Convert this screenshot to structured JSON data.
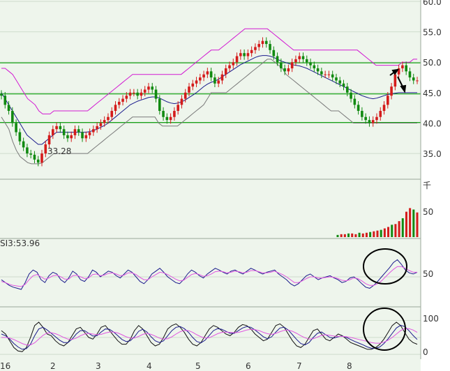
{
  "colors": {
    "background": "#eef5ec",
    "grid": "#cfdccc",
    "level_line": "#1aa51a",
    "up_candle": "#d41b1b",
    "down_candle": "#118a11",
    "ma_blue": "#1a1a8c",
    "band_magenta": "#d21ad2",
    "band_gray": "#7a7a7a",
    "indicator_black": "#111111",
    "indicator_pink": "#e055e0",
    "annotation": "#000000"
  },
  "chart_data": [
    {
      "type": "candlestick",
      "title": "",
      "ylim": [
        31,
        60
      ],
      "yticks": [
        "60.0",
        "55.0",
        "50.0",
        "45.0",
        "40.0",
        "35.0"
      ],
      "x_labels": [
        "16",
        "2",
        "3",
        "4",
        "5",
        "6",
        "7",
        "8"
      ],
      "horizontal_levels": [
        49.9,
        44.8,
        40.1
      ],
      "low_annotation": "33.28",
      "close_series": [
        44.5,
        43,
        42,
        40,
        38.5,
        37,
        36,
        35,
        34.8,
        34,
        33.5,
        35,
        36.5,
        38,
        39,
        39.5,
        39,
        38,
        37.5,
        38,
        39,
        38.5,
        37.5,
        38,
        38.5,
        39,
        39.5,
        40,
        40.5,
        41,
        42,
        43,
        43.5,
        44,
        44.5,
        45,
        45,
        44.5,
        45,
        45.5,
        46,
        45.5,
        44,
        42,
        41,
        40.5,
        41,
        42,
        43,
        44,
        45,
        46,
        46.5,
        47,
        47.5,
        48,
        48.5,
        47.5,
        46.5,
        47,
        48,
        49,
        49.5,
        50,
        51,
        51.5,
        51,
        51.5,
        52,
        52.5,
        53,
        53.5,
        53,
        52,
        51,
        50,
        49,
        48.5,
        49,
        50,
        50.5,
        51,
        50.5,
        50,
        49.5,
        49,
        48.5,
        48,
        48,
        48,
        47.5,
        47,
        46.5,
        46,
        45,
        44,
        43,
        42,
        41,
        40.5,
        40,
        40.5,
        41,
        42,
        43,
        44.5,
        46,
        48,
        49,
        49.5,
        48.5,
        47.5,
        47,
        47
      ],
      "series": [
        {
          "name": "",
          "values": [
            45,
            44,
            43,
            42,
            41,
            40,
            39,
            38,
            37.5,
            37,
            36.5,
            36.5,
            37,
            37.5,
            38,
            38.5,
            38.5,
            38.5,
            38.5,
            38.5,
            38.5,
            38.5,
            38.5,
            38.5,
            38.6,
            38.8,
            39,
            39.3,
            39.6,
            40,
            40.5,
            41,
            41.5,
            42,
            42.5,
            43,
            43.3,
            43.6,
            43.8,
            44,
            44.2,
            44.3,
            44.3,
            44.1,
            43.8,
            43.5,
            43.3,
            43.2,
            43.3,
            43.5,
            43.8,
            44.2,
            44.6,
            45,
            45.5,
            46,
            46.4,
            46.7,
            46.9,
            47.2,
            47.6,
            48,
            48.4,
            48.8,
            49.2,
            49.6,
            49.9,
            50.2,
            50.5,
            50.8,
            51,
            51.1,
            51.1,
            51,
            50.8,
            50.5,
            50.2,
            50,
            49.8,
            49.6,
            49.5,
            49.4,
            49.2,
            49,
            48.7,
            48.4,
            48.1,
            47.8,
            47.5,
            47.2,
            46.9,
            46.6,
            46.3,
            46,
            45.7,
            45.4,
            45.1,
            44.8,
            44.5,
            44.3,
            44.1,
            44,
            44.1,
            44.3,
            44.5,
            44.7,
            44.8,
            44.9,
            45,
            45,
            45,
            45,
            45,
            45
          ]
        },
        {
          "name": "",
          "values": [
            49,
            49,
            48.5,
            48,
            47,
            46,
            45,
            44,
            43.5,
            43,
            42,
            41.5,
            41.5,
            41.5,
            42,
            42,
            42,
            42,
            42,
            42,
            42,
            42,
            42,
            42,
            42.5,
            43,
            43.5,
            44,
            44.5,
            45,
            45.5,
            46,
            46.5,
            47,
            47.5,
            48,
            48,
            48,
            48,
            48,
            48,
            48,
            48,
            48,
            48,
            48,
            48,
            48,
            48,
            48.5,
            49,
            49.5,
            50,
            50.5,
            51,
            51.5,
            52,
            52,
            52,
            52.5,
            53,
            53.5,
            54,
            54.5,
            55,
            55.5,
            55.5,
            55.5,
            55.5,
            55.5,
            55.5,
            55.5,
            55,
            54.5,
            54,
            53.5,
            53,
            52.5,
            52,
            52,
            52,
            52,
            52,
            52,
            52,
            52,
            52,
            52,
            52,
            52,
            52,
            52,
            52,
            52,
            52,
            52,
            51.5,
            51,
            50.5,
            50,
            49.5,
            49.5,
            49.5,
            49.5,
            49.5,
            49.5,
            49.5,
            50,
            50,
            50,
            50.5,
            50.5
          ]
        },
        {
          "name": "",
          "values": [
            41,
            40,
            39,
            37,
            35.5,
            34.5,
            34,
            33.5,
            33.3,
            33.3,
            33.3,
            33.5,
            34,
            34.5,
            35,
            35,
            35,
            35,
            35,
            35,
            35,
            35,
            35,
            35,
            35.5,
            36,
            36.5,
            37,
            37.5,
            38,
            38.5,
            39,
            39.5,
            40,
            40.5,
            41,
            41,
            41,
            41,
            41,
            41,
            41,
            40,
            39.5,
            39.5,
            39.5,
            39.5,
            39.5,
            40,
            40.5,
            41,
            41.5,
            42,
            42.5,
            43,
            44,
            45,
            45,
            45,
            45,
            45,
            45.5,
            46,
            46.5,
            47,
            47.5,
            48,
            48.5,
            49,
            49.5,
            50,
            50.5,
            50.5,
            50,
            49.5,
            49,
            48,
            47.5,
            47,
            46.5,
            46,
            45.5,
            45,
            44.5,
            44,
            43.5,
            43,
            42.5,
            42,
            42,
            42,
            41.5,
            41,
            40.5,
            40,
            40,
            40,
            40,
            40,
            40,
            40,
            40,
            40,
            40,
            40,
            40,
            40,
            40,
            40,
            40,
            40,
            40
          ]
        }
      ]
    },
    {
      "type": "bar",
      "title": "",
      "unit_label": "千",
      "yticks": [
        "50"
      ],
      "ylim": [
        0,
        75
      ],
      "values": [
        0,
        0,
        0,
        0,
        0,
        0,
        0,
        0,
        0,
        0,
        0,
        0,
        0,
        0,
        0,
        0,
        0,
        0,
        0,
        0,
        0,
        0,
        0,
        0,
        0,
        0,
        0,
        0,
        0,
        0,
        0,
        0,
        0,
        0,
        0,
        0,
        0,
        0,
        0,
        0,
        0,
        0,
        0,
        0,
        0,
        0,
        0,
        0,
        0,
        0,
        0,
        0,
        0,
        0,
        0,
        0,
        0,
        0,
        0,
        0,
        0,
        0,
        0,
        0,
        0,
        0,
        0,
        0,
        0,
        0,
        0,
        0,
        0,
        0,
        0,
        0,
        0,
        0,
        0,
        0,
        0,
        0,
        0,
        0,
        0,
        0,
        0,
        0,
        0,
        0,
        0,
        0,
        0,
        3,
        4,
        4,
        5,
        5,
        4,
        6,
        5,
        6,
        7,
        8,
        9,
        10,
        12,
        14,
        17,
        18,
        22,
        26,
        35,
        40,
        38,
        34
      ]
    },
    {
      "type": "line",
      "title": "SI3:53.96",
      "yticks": [
        "50"
      ],
      "ylim": [
        0,
        100
      ],
      "series": [
        {
          "name": "",
          "values": [
            45,
            40,
            35,
            32,
            30,
            28,
            40,
            55,
            62,
            58,
            45,
            40,
            52,
            58,
            55,
            45,
            40,
            48,
            60,
            55,
            45,
            42,
            50,
            62,
            58,
            50,
            55,
            60,
            58,
            52,
            48,
            55,
            62,
            58,
            50,
            42,
            38,
            45,
            55,
            60,
            65,
            58,
            50,
            45,
            40,
            38,
            45,
            55,
            62,
            58,
            52,
            48,
            55,
            60,
            65,
            62,
            58,
            55,
            60,
            62,
            58,
            55,
            60,
            65,
            62,
            58,
            55,
            58,
            60,
            62,
            55,
            50,
            45,
            38,
            34,
            38,
            45,
            52,
            55,
            50,
            45,
            48,
            50,
            52,
            48,
            45,
            40,
            42,
            48,
            50,
            45,
            38,
            32,
            30,
            35,
            42,
            50,
            58,
            66,
            75,
            80,
            72,
            62,
            57,
            55,
            58
          ]
        },
        {
          "name": "",
          "values": [
            42,
            40,
            37,
            35,
            34,
            33,
            37,
            45,
            52,
            54,
            50,
            46,
            48,
            52,
            53,
            50,
            46,
            46,
            52,
            53,
            50,
            47,
            48,
            54,
            55,
            52,
            53,
            56,
            57,
            55,
            52,
            53,
            57,
            57,
            54,
            49,
            45,
            45,
            50,
            54,
            58,
            57,
            54,
            50,
            46,
            43,
            44,
            49,
            54,
            56,
            54,
            51,
            52,
            55,
            59,
            60,
            59,
            57,
            58,
            60,
            59,
            57,
            58,
            61,
            61,
            59,
            57,
            57,
            58,
            60,
            57,
            54,
            50,
            45,
            40,
            40,
            43,
            47,
            50,
            50,
            48,
            48,
            49,
            50,
            49,
            47,
            44,
            43,
            45,
            48,
            47,
            43,
            38,
            35,
            35,
            38,
            43,
            50,
            57,
            63,
            68,
            68,
            65,
            61,
            58,
            58
          ]
        }
      ]
    },
    {
      "type": "line",
      "title": "",
      "yticks": [
        "100",
        "0"
      ],
      "ylim": [
        -12,
        132
      ],
      "series": [
        {
          "name": "",
          "values": [
            70,
            60,
            40,
            20,
            10,
            8,
            20,
            50,
            85,
            95,
            80,
            60,
            55,
            40,
            30,
            25,
            35,
            55,
            75,
            80,
            65,
            50,
            45,
            60,
            80,
            85,
            70,
            55,
            40,
            30,
            30,
            45,
            70,
            85,
            75,
            55,
            35,
            25,
            30,
            50,
            75,
            85,
            90,
            80,
            65,
            45,
            30,
            25,
            35,
            55,
            75,
            85,
            80,
            70,
            60,
            55,
            65,
            80,
            88,
            85,
            75,
            60,
            50,
            40,
            45,
            65,
            85,
            90,
            80,
            60,
            40,
            25,
            20,
            30,
            50,
            70,
            75,
            60,
            45,
            40,
            50,
            60,
            55,
            45,
            35,
            30,
            25,
            20,
            15,
            15,
            20,
            30,
            45,
            65,
            85,
            95,
            85,
            65,
            45,
            35,
            30
          ]
        },
        {
          "name": "",
          "values": [
            60,
            55,
            45,
            32,
            22,
            15,
            17,
            30,
            55,
            75,
            80,
            72,
            62,
            52,
            42,
            35,
            35,
            45,
            60,
            70,
            70,
            62,
            54,
            55,
            66,
            75,
            74,
            66,
            55,
            44,
            38,
            40,
            52,
            68,
            74,
            66,
            52,
            40,
            35,
            40,
            55,
            70,
            80,
            82,
            76,
            65,
            50,
            38,
            34,
            42,
            56,
            70,
            76,
            74,
            68,
            62,
            62,
            70,
            78,
            82,
            80,
            72,
            62,
            52,
            46,
            52,
            66,
            78,
            80,
            72,
            58,
            44,
            32,
            28,
            35,
            50,
            62,
            66,
            58,
            50,
            48,
            52,
            54,
            50,
            44,
            38,
            33,
            28,
            22,
            18,
            18,
            22,
            32,
            46,
            62,
            78,
            86,
            82,
            70,
            56,
            44
          ]
        },
        {
          "name": "",
          "values": [
            50,
            50,
            48,
            44,
            38,
            32,
            28,
            28,
            34,
            45,
            56,
            63,
            64,
            61,
            56,
            50,
            45,
            44,
            48,
            55,
            60,
            62,
            60,
            58,
            59,
            63,
            66,
            66,
            63,
            58,
            52,
            48,
            48,
            53,
            59,
            62,
            59,
            54,
            48,
            45,
            46,
            52,
            60,
            67,
            71,
            70,
            65,
            58,
            52,
            48,
            49,
            55,
            61,
            65,
            66,
            65,
            64,
            65,
            68,
            72,
            74,
            73,
            70,
            65,
            61,
            59,
            62,
            67,
            71,
            72,
            68,
            62,
            55,
            49,
            45,
            46,
            51,
            56,
            58,
            56,
            54,
            53,
            53,
            52,
            50,
            47,
            44,
            41,
            38,
            35,
            33,
            33,
            36,
            42,
            50,
            60,
            70,
            76,
            76,
            72,
            65
          ]
        }
      ]
    }
  ]
}
